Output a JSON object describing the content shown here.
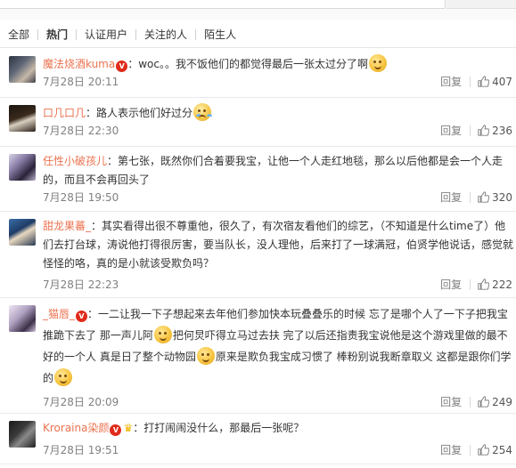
{
  "filter_tabs": [
    {
      "label": "全部",
      "active": false
    },
    {
      "label": "热门",
      "active": true
    },
    {
      "label": "认证用户",
      "active": false
    },
    {
      "label": "关注的人",
      "active": false
    },
    {
      "label": "陌生人",
      "active": false
    }
  ],
  "reply_label": "回复",
  "comments": [
    {
      "user": "魔法烧酒kuma",
      "text": "：woc。。我不饭他们的都觉得最后一张太过分了啊",
      "time": "7月28日 20:11",
      "likes": "407"
    },
    {
      "user": "口几口几",
      "text": "：路人表示他们好过分",
      "time": "7月28日 22:30",
      "likes": "236"
    },
    {
      "user": "任性小破孩儿",
      "text": "：第七张，既然你们合着要我宝，让他一个人走红地毯，那么以后他都是会一个人走的，而且不会再回头了",
      "time": "7月28日 19:50",
      "likes": "320"
    },
    {
      "user": "甜龙果蕃_",
      "text": "：其实看得出很不尊重他，很久了，有次宿友看他们的综艺，（不知道是什么time了）他们去打台球，涛说他打得很厉害，要当队长，没人理他，后来打了一球满冠，伯贤学他说话，感觉就怪怪的咯，真的是小就该受欺负吗？",
      "time": "7月28日 22:23",
      "likes": "222"
    },
    {
      "user": "_猫唇_",
      "text_1": "：一二让我一下子想起来去年他们参加快本玩叠叠乐的时候 忘了是哪个人了一下子把我宝推跪下去了 那一声儿阿",
      "text_2": "把何炅吓得立马过去扶 完了以后还指责我宝说他是这个游戏里做的最不好的一个人 真是日了整个动物园",
      "text_3": "原来是欺负我宝成习惯了 棒粉别说我断章取义 这都是跟你们学的",
      "time": "7月28日 20:09",
      "likes": "249"
    },
    {
      "user": "Kroraina染颜",
      "text": "：打打闹闹没什么，那最后一张呢？",
      "time": "7月28日 19:51",
      "likes": "254"
    }
  ],
  "icons": {
    "verified": "v-badge-icon",
    "emoji": "smiley-emoji-icon",
    "like": "thumbs-up-icon",
    "crown": "crown-icon"
  },
  "colors": {
    "username": "#eb7350",
    "meta": "#808080",
    "verified": "#e02b1a"
  }
}
